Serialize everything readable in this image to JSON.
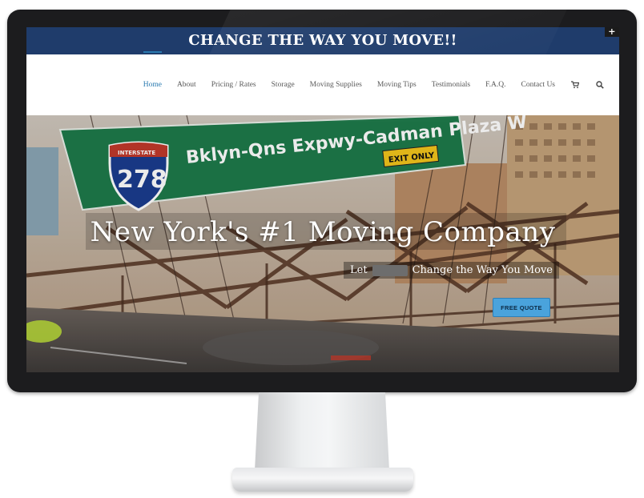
{
  "banner": {
    "text": "CHANGE THE WAY YOU MOVE!!",
    "toggle_icon": "plus-icon"
  },
  "nav": {
    "items": [
      {
        "label": "Home",
        "active": true
      },
      {
        "label": "About"
      },
      {
        "label": "Pricing / Rates"
      },
      {
        "label": "Storage"
      },
      {
        "label": "Moving Supplies"
      },
      {
        "label": "Moving Tips"
      },
      {
        "label": "Testimonials"
      },
      {
        "label": "F.A.Q."
      },
      {
        "label": "Contact Us"
      }
    ],
    "cart_icon": "cart-icon",
    "search_icon": "search-icon"
  },
  "hero": {
    "headline": "New York's #1 Moving Company",
    "tagline_pre": "Let",
    "tagline_post": "Change the Way You Move",
    "cta": "FREE QUOTE",
    "sign_text": "Bklyn-Qns Expwy-Cadman Plaza W",
    "exit_text": "EXIT ONLY",
    "shield_top": "INTERSTATE",
    "shield_number": "278"
  },
  "colors": {
    "banner_bg": "#1f3c6b",
    "nav_active": "#2a7ab0",
    "cta_bg": "#4aa3dc",
    "sign_green": "#1e7a4a"
  }
}
